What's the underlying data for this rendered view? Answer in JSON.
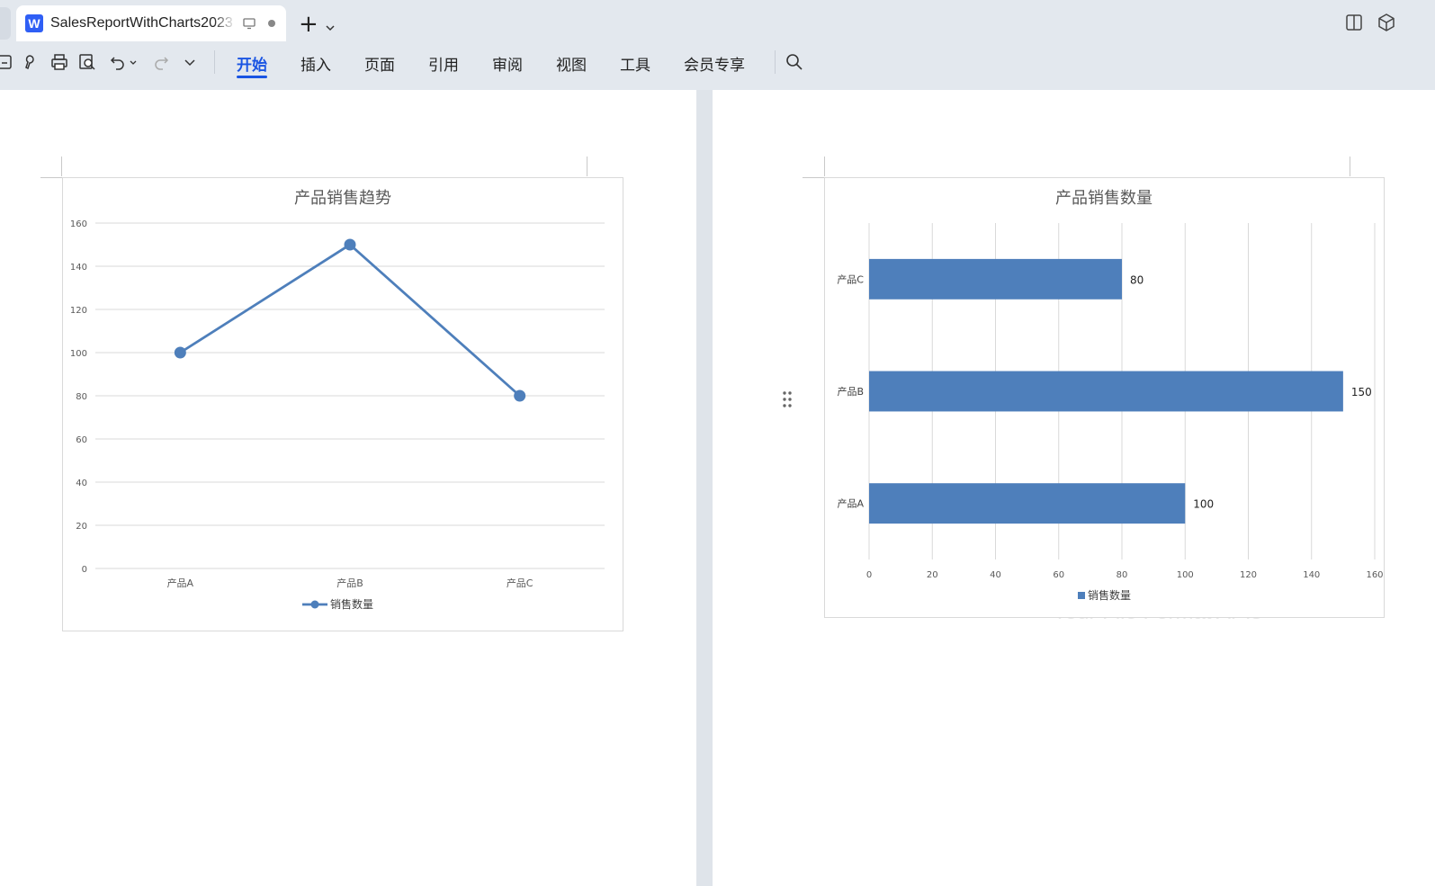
{
  "window": {
    "tab_title": "SalesReportWithCharts2023",
    "app_badge": "W",
    "new_tab_symbol": "+"
  },
  "menu": {
    "items": [
      "开始",
      "插入",
      "页面",
      "引用",
      "审阅",
      "视图",
      "工具",
      "会员专享"
    ],
    "active": "开始"
  },
  "watermark": "Your File Format APIs",
  "colors": {
    "accent": "#1a55e3",
    "series": "#4e7fbb",
    "gridline": "#d9d9d9"
  },
  "chart_data": [
    {
      "type": "line",
      "title": "产品销售趋势",
      "categories": [
        "产品A",
        "产品B",
        "产品C"
      ],
      "series": [
        {
          "name": "销售数量",
          "values": [
            100,
            150,
            80
          ]
        }
      ],
      "ylim": [
        0,
        160
      ],
      "y_ticks": [
        0,
        20,
        40,
        60,
        80,
        100,
        120,
        140,
        160
      ],
      "grid": true,
      "legend": "bottom",
      "markers": true
    },
    {
      "type": "bar",
      "orientation": "horizontal",
      "title": "产品销售数量",
      "categories": [
        "产品A",
        "产品B",
        "产品C"
      ],
      "series": [
        {
          "name": "销售数量",
          "values": [
            100,
            150,
            80
          ]
        }
      ],
      "xlim": [
        0,
        160
      ],
      "x_ticks": [
        0,
        20,
        40,
        60,
        80,
        100,
        120,
        140,
        160
      ],
      "grid": true,
      "legend": "bottom",
      "data_labels": true
    }
  ]
}
